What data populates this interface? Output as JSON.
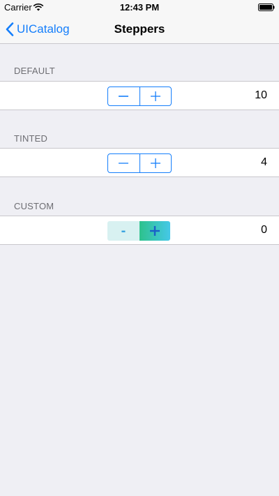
{
  "status_bar": {
    "carrier": "Carrier",
    "time": "12:43 PM"
  },
  "nav": {
    "back_label": "UICatalog",
    "title": "Steppers"
  },
  "sections": [
    {
      "header": "DEFAULT",
      "value": "10",
      "style": "default"
    },
    {
      "header": "TINTED",
      "value": "4",
      "style": "tinted"
    },
    {
      "header": "CUSTOM",
      "value": "0",
      "style": "custom"
    }
  ],
  "custom_stepper": {
    "decrement_label": "-"
  },
  "colors": {
    "accent": "#147efb",
    "background": "#efeff4",
    "custom_increment_gradient_start": "#2ec28c",
    "custom_increment_gradient_end": "#45c8e8",
    "custom_decrement_bg": "#d8f1f1"
  },
  "icons": {
    "status": [
      "wifi-icon",
      "battery-icon"
    ],
    "nav_back": "chevron-left-icon",
    "stepper": [
      "minus-icon",
      "plus-icon"
    ]
  }
}
